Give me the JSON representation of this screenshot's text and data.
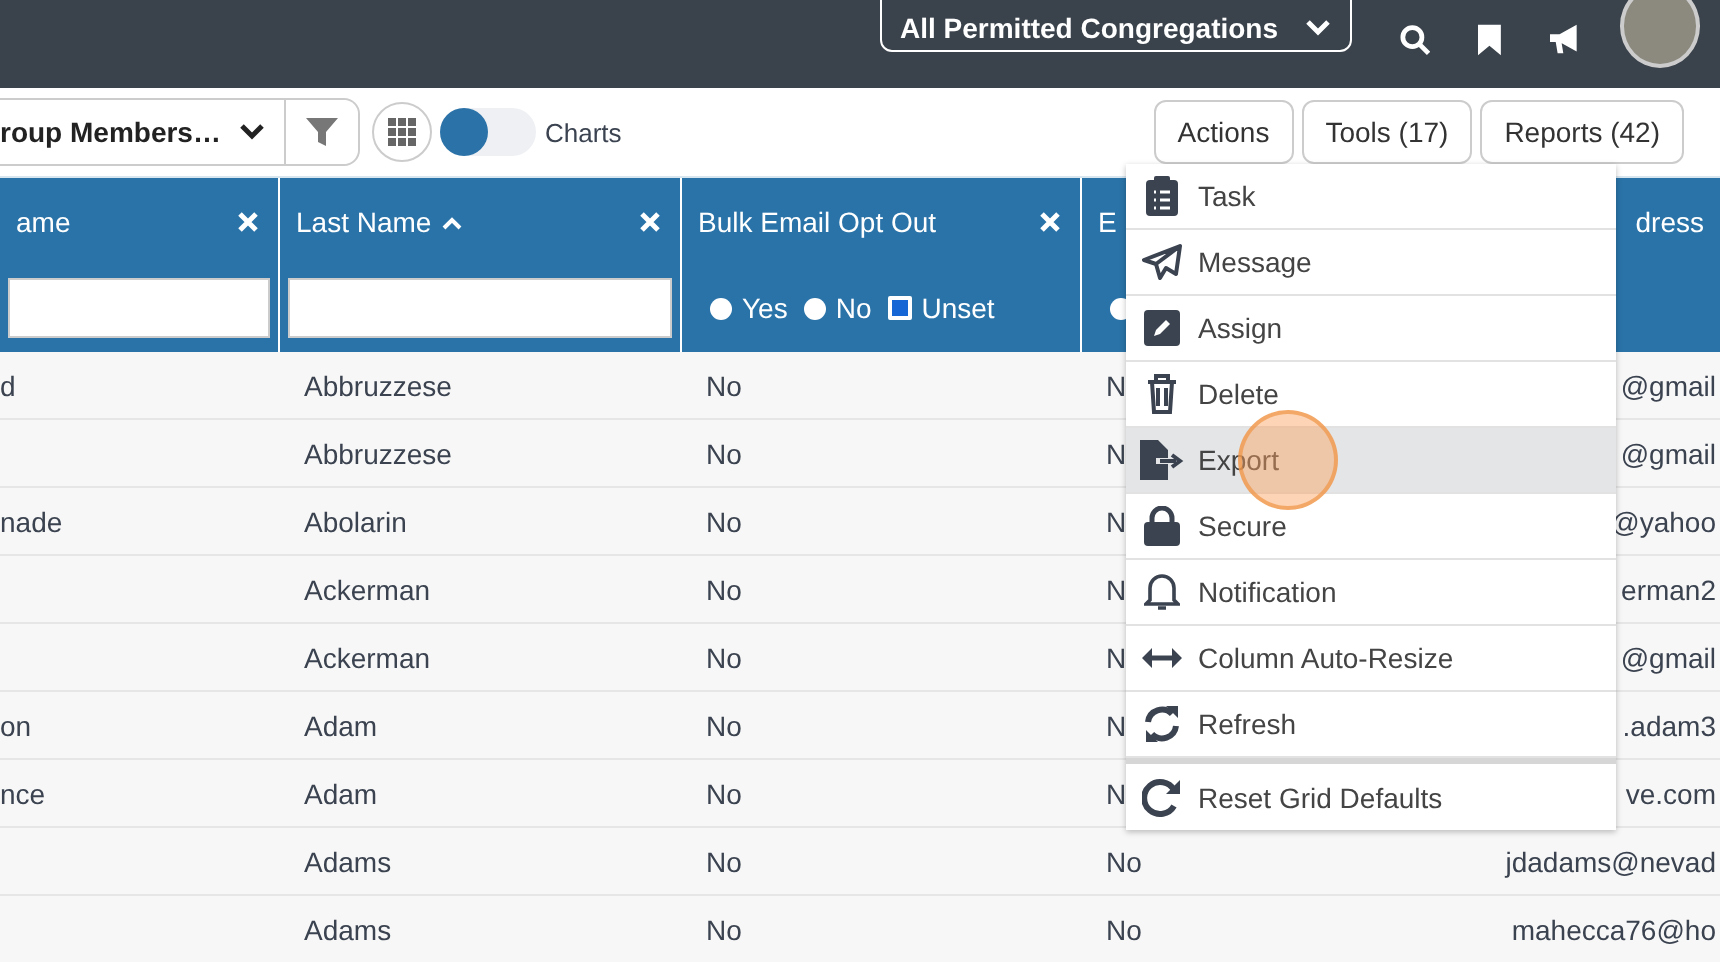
{
  "top_bar": {
    "congregation_select": "All Permitted Congregations"
  },
  "toolbar": {
    "view_select": "roup Members…",
    "charts_toggle": {
      "label": "Charts",
      "on": false
    },
    "buttons": [
      "Actions",
      "Tools (17)",
      "Reports (42)"
    ]
  },
  "table": {
    "columns": [
      {
        "header": "ame",
        "closable": true,
        "sorted": false,
        "kind": "text-filter"
      },
      {
        "header": "Last Name",
        "sorted": true,
        "closable": true,
        "kind": "text-filter"
      },
      {
        "header": "Bulk Email Opt Out",
        "closable": true,
        "sorted": false,
        "kind": "radio-filter",
        "options": [
          {
            "label": "Yes",
            "selected": false
          },
          {
            "label": "No",
            "selected": false
          },
          {
            "label": "Unset",
            "selected": true
          }
        ]
      },
      {
        "header": "E",
        "kind": "radio-filter",
        "options": [
          {
            "selected": false
          }
        ]
      },
      {
        "header": "dress",
        "kind": "plain"
      }
    ],
    "rows": [
      {
        "cells": [
          "d",
          "Abbruzzese",
          "No",
          "N",
          "@gmail"
        ]
      },
      {
        "cells": [
          "",
          "Abbruzzese",
          "No",
          "N",
          "@gmail"
        ]
      },
      {
        "cells": [
          "nade",
          "Abolarin",
          "No",
          "N",
          "@yahoo"
        ]
      },
      {
        "cells": [
          "",
          "Ackerman",
          "No",
          "N",
          "erman2"
        ]
      },
      {
        "cells": [
          "",
          "Ackerman",
          "No",
          "N",
          "@gmail"
        ]
      },
      {
        "cells": [
          "on",
          "Adam",
          "No",
          "N",
          ".adam3"
        ]
      },
      {
        "cells": [
          "nce",
          "Adam",
          "No",
          "N",
          "ve.com"
        ]
      },
      {
        "cells": [
          "",
          "Adams",
          "No",
          "No",
          "jdadams@nevad"
        ]
      },
      {
        "cells": [
          "",
          "Adams",
          "No",
          "No",
          "mahecca76@ho"
        ]
      }
    ]
  },
  "actions_menu": {
    "items": [
      {
        "label": "Task",
        "selected": false
      },
      {
        "label": "Message",
        "selected": false
      },
      {
        "label": "Assign",
        "selected": false
      },
      {
        "label": "Delete",
        "selected": false
      },
      {
        "label": "Export",
        "selected": true
      },
      {
        "label": "Secure",
        "selected": false
      },
      {
        "label": "Notification",
        "selected": false
      },
      {
        "label": "Column Auto-Resize",
        "selected": false
      },
      {
        "label": "Refresh",
        "selected": false
      },
      {
        "label": "Reset Grid Defaults",
        "selected": false,
        "separated": true
      }
    ]
  }
}
